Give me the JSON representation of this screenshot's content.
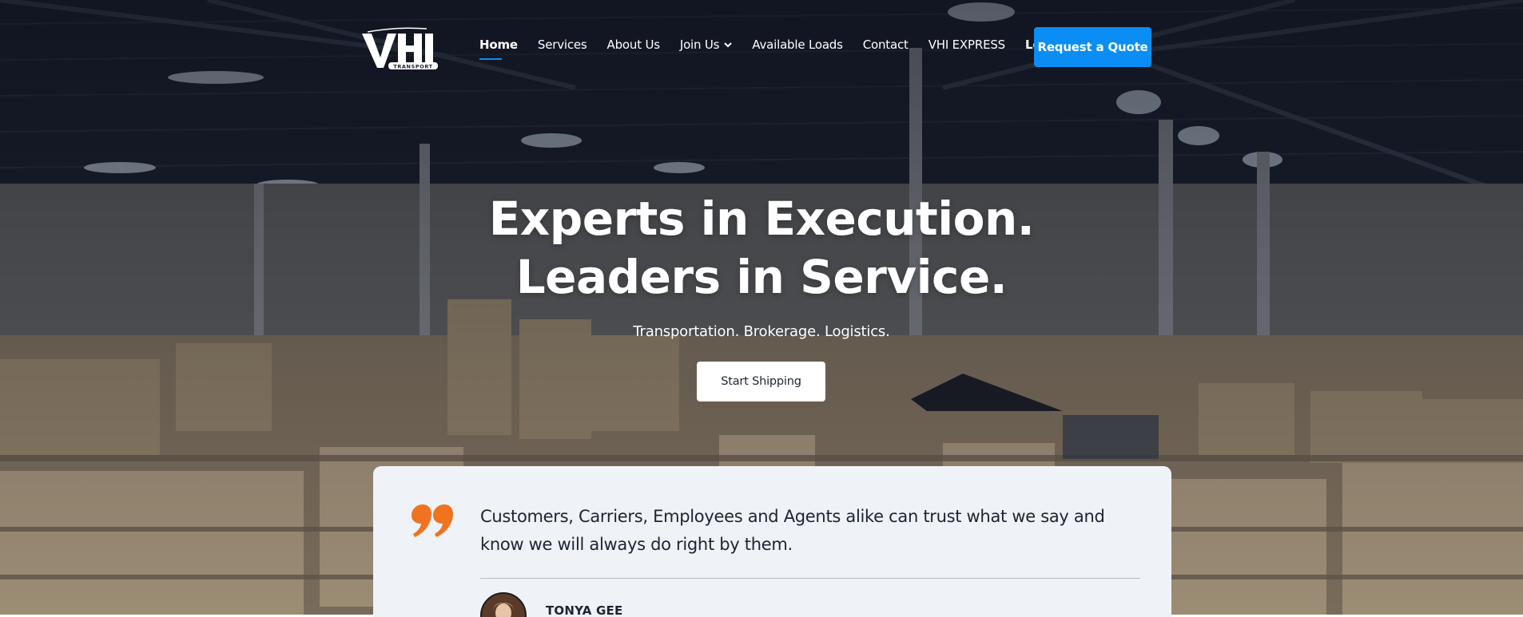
{
  "brand": {
    "logo_text": "VHI",
    "logo_subtext": "TRANSPORT"
  },
  "nav": {
    "items": [
      {
        "label": "Home",
        "active": true
      },
      {
        "label": "Services"
      },
      {
        "label": "About Us"
      },
      {
        "label": "Join Us",
        "has_dropdown": true
      },
      {
        "label": "Available Loads"
      },
      {
        "label": "Contact"
      },
      {
        "label": "VHI EXPRESS"
      },
      {
        "label": "Login"
      }
    ],
    "cta_label": "Request a Quote"
  },
  "hero": {
    "headline_line1": "Experts in Execution.",
    "headline_line2": "Leaders in Service.",
    "subtitle": "Transportation. Brokerage. Logistics.",
    "button_label": "Start Shipping"
  },
  "testimonial": {
    "quote": "Customers, Carriers, Employees and Agents alike can trust what we say and know we will always do right by them.",
    "author": "TONYA GEE"
  },
  "colors": {
    "accent_blue": "#0a8ef5",
    "quote_orange": "#f0731f",
    "card_bg": "#eff2f6",
    "text_dark": "#1c2432"
  },
  "icons": {
    "quote_mark": "quote-icon",
    "dropdown": "chevron-down-icon"
  }
}
